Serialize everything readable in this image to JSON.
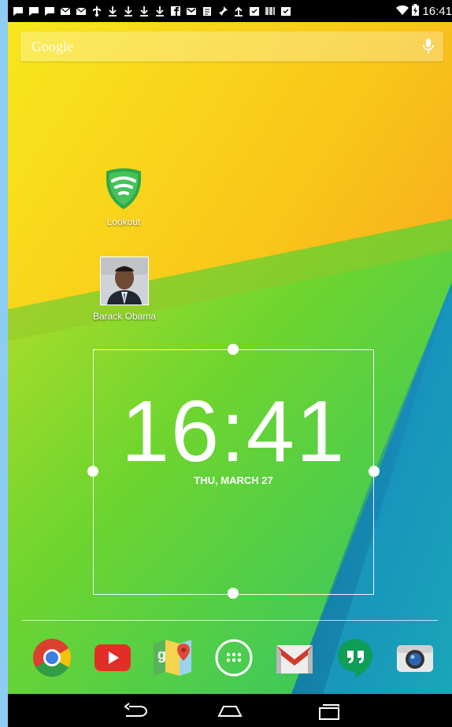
{
  "status_bar": {
    "time": "16:41",
    "notification_icons": [
      "message-icon",
      "message-icon",
      "message-icon",
      "mail-icon",
      "mail-icon",
      "usb-icon",
      "download-icon",
      "download-icon",
      "download-icon",
      "download-icon",
      "download-icon",
      "facebook-icon",
      "gmail-icon",
      "clipboard-icon",
      "pin-icon",
      "upload-icon",
      "check-icon",
      "barcode-icon",
      "check-icon"
    ],
    "wifi_icon": "wifi-icon",
    "battery_icon": "battery-icon"
  },
  "search": {
    "logo": "Google",
    "mic_icon": "mic-icon"
  },
  "desktop": {
    "items": [
      {
        "label": "Lookout",
        "icon": "lookout-shield-icon"
      },
      {
        "label": "Barack Obama",
        "icon": "contact-photo-icon"
      }
    ]
  },
  "widget": {
    "time": "16:41",
    "date": "THU, MARCH 27"
  },
  "dock": {
    "apps": [
      "chrome-icon",
      "youtube-icon",
      "maps-icon",
      "app-drawer-icon",
      "gmail-icon",
      "hangouts-icon",
      "camera-icon"
    ]
  },
  "navbar": {
    "buttons": [
      "back-icon",
      "home-icon",
      "recents-icon"
    ]
  },
  "colors": {
    "wallpaper_yellow": "#f7dc16",
    "wallpaper_orange": "#f7941d",
    "wallpaper_green": "#5fd12a",
    "wallpaper_blue": "#1a8ed0",
    "lookout_green": "#3aa53a"
  }
}
